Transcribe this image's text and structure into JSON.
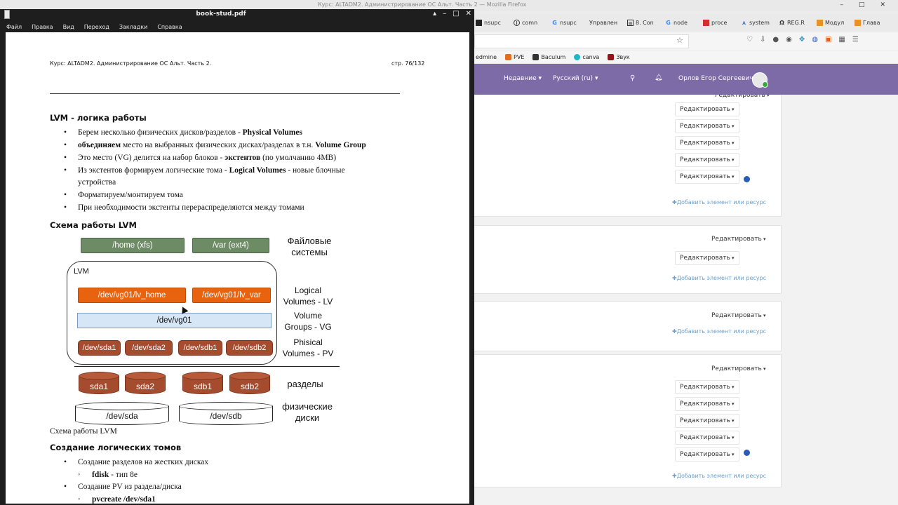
{
  "firefox": {
    "window_title": "Курс: ALTADM2. Администрирование ОС Альт. Часть 2 — Mozilla Firefox",
    "tabs": [
      {
        "label": "nsupc",
        "icon": "black-square-icon"
      },
      {
        "label": "comn",
        "icon": "info-circle-icon"
      },
      {
        "label": "nsupc",
        "icon": "google-g-icon"
      },
      {
        "label": "Управлен",
        "icon": "none"
      },
      {
        "label": "8. Con",
        "icon": "book-icon"
      },
      {
        "label": "node",
        "icon": "google-g-icon"
      },
      {
        "label": "proce",
        "icon": "red-square-icon"
      },
      {
        "label": "system",
        "icon": "blue-a-icon"
      },
      {
        "label": "REG.R",
        "icon": "omega-icon"
      },
      {
        "label": "Модул",
        "icon": "orange-grid-icon"
      },
      {
        "label": "Глава",
        "icon": "orange-grid-icon"
      }
    ],
    "bookmarks": [
      {
        "label": "edmine",
        "color": "#bbbbbb"
      },
      {
        "label": "PVE",
        "color": "#e07020"
      },
      {
        "label": "Baculum",
        "color": "#333333"
      },
      {
        "label": "canva",
        "color": "#1fb6c8"
      },
      {
        "label": "Звук",
        "color": "#8a1a1a"
      }
    ]
  },
  "site": {
    "nav_recent": "Недавние",
    "nav_lang": "Русский (ru)",
    "user_name": "Орлов Егор Сергеевич",
    "edit_label": "Редактировать",
    "add_link": "Добавить элемент или ресурс"
  },
  "pdf": {
    "title": "book-stud.pdf",
    "menu": [
      "Файл",
      "Правка",
      "Вид",
      "Переход",
      "Закладки",
      "Справка"
    ],
    "header_left": "Курс: ALTADM2. Администрирование ОС Альт. Часть 2.",
    "header_right": "стр. 76/132",
    "section1_title": "LVM - логика работы",
    "b1": {
      "t1": "Берем несколько физических дисков/разделов - ",
      "b1": "Physical Volumes"
    },
    "b2": {
      "b1": "объединяем",
      "t1": " место на выбранных физических дисках/разделах в т.н. ",
      "b2": "Volume Group"
    },
    "b3": {
      "t1": "Это место (VG) делится на набор блоков - ",
      "b1": "экстентов",
      "t2": " (по умолчанию 4MB)"
    },
    "b4": {
      "t1": "Из экстентов формируем логические тома - ",
      "b1": "Logical Volumes",
      "t2": " - новые блочные",
      "t3": "устройства"
    },
    "b5": "Форматируем/монтируем тома",
    "b6": "При необходимости экстенты перераспределяются между томами",
    "section2_title": "Схема работы LVM",
    "diagram": {
      "fs_home": "/home (xfs)",
      "fs_var": "/var (ext4)",
      "fs_label_1": "Файловые",
      "fs_label_2": "системы",
      "lvm_label": "LVM",
      "lv_home": "/dev/vg01/lv_home",
      "lv_var": "/dev/vg01/lv_var",
      "lv_label_1": "Logical",
      "lv_label_2": "Volumes - LV",
      "vg": "/dev/vg01",
      "vg_label_1": "Volume",
      "vg_label_2": "Groups - VG",
      "pv": [
        "/dev/sda1",
        "/dev/sda2",
        "/dev/sdb1",
        "/dev/sdb2"
      ],
      "pv_label_1": "Phisical",
      "pv_label_2": "Volumes - PV",
      "partitions": [
        "sda1",
        "sda2",
        "sdb1",
        "sdb2"
      ],
      "partitions_label": "разделы",
      "disks": [
        "/dev/sda",
        "/dev/sdb"
      ],
      "disks_label_1": "физические",
      "disks_label_2": "диски"
    },
    "caption": "Схема работы LVM",
    "section3_title": "Создание логических томов",
    "c1": "Создание разделов на жестких дисках",
    "c1_sub": {
      "b1": "fdisk",
      "t1": " - тип 8e"
    },
    "c2": "Создание PV из раздела/диска",
    "c2_sub": "pvcreate /dev/sda1"
  }
}
